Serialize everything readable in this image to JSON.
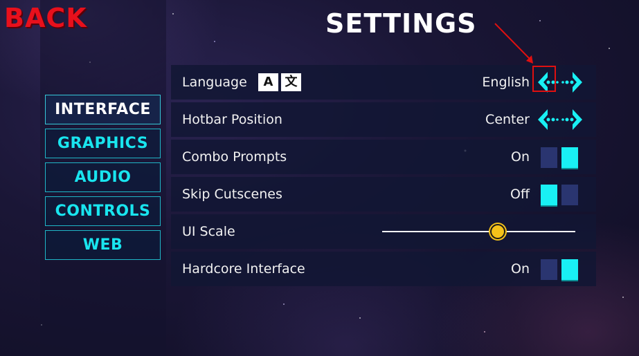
{
  "header": {
    "back_label": "BACK",
    "title": "SETTINGS"
  },
  "nav": {
    "items": [
      {
        "label": "INTERFACE",
        "active": true
      },
      {
        "label": "GRAPHICS",
        "active": false
      },
      {
        "label": "AUDIO",
        "active": false
      },
      {
        "label": "CONTROLS",
        "active": false
      },
      {
        "label": "WEB",
        "active": false
      }
    ]
  },
  "settings": {
    "language": {
      "label": "Language",
      "icon_a": "A",
      "icon_b": "文",
      "value": "English"
    },
    "hotbar": {
      "label": "Hotbar Position",
      "value": "Center"
    },
    "combo": {
      "label": "Combo Prompts",
      "value": "On",
      "state": true
    },
    "cutscenes": {
      "label": "Skip Cutscenes",
      "value": "Off",
      "state": false
    },
    "ui_scale": {
      "label": "UI Scale",
      "level": 0.6
    },
    "hardcore": {
      "label": "Hardcore Interface",
      "value": "On",
      "state": true
    }
  },
  "colors": {
    "accent": "#19f0f4",
    "back": "#e8101c",
    "annotation": "#e01010",
    "knob": "#f4c21a"
  }
}
